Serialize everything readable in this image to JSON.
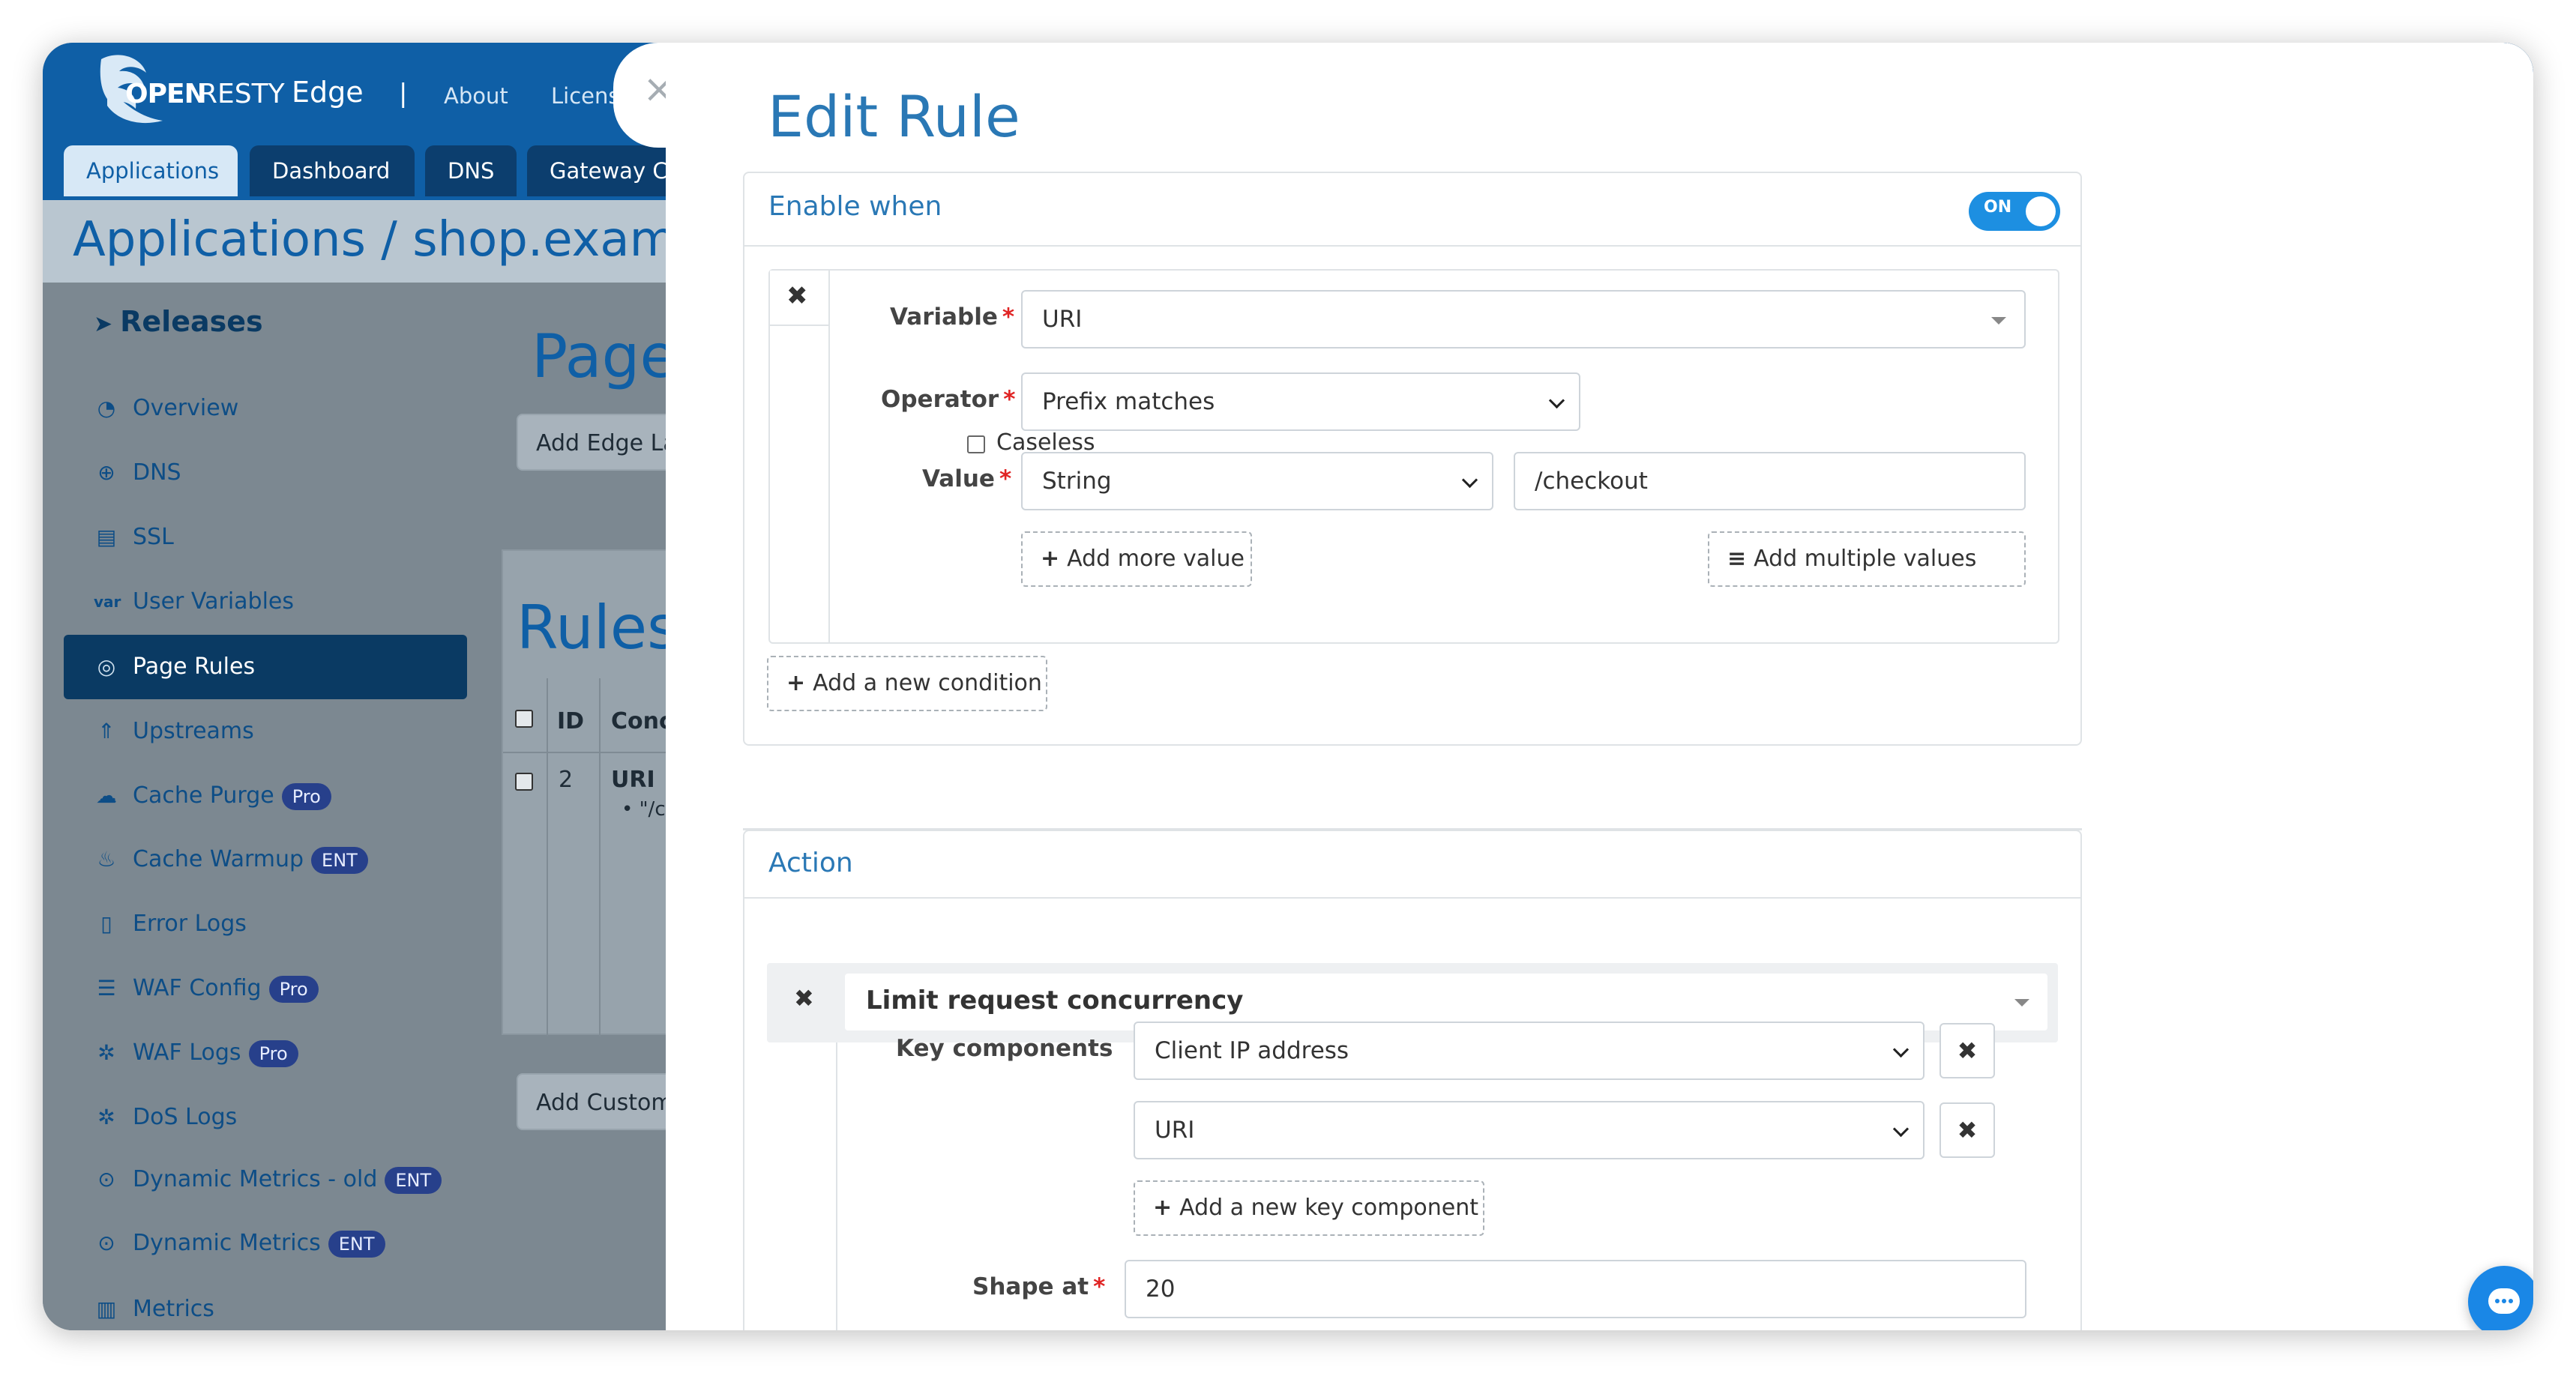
{
  "app": {
    "brand_open": "OPEN",
    "brand_resty": "RESTY",
    "brand_edge": "Edge",
    "separator": "|",
    "nav": {
      "about": "About",
      "license": "Licens"
    },
    "tabs": [
      "Applications",
      "Dashboard",
      "DNS",
      "Gateway Cl"
    ],
    "breadcrumb": "Applications / shop.examp"
  },
  "sidebar": {
    "heading": "Releases",
    "items": [
      {
        "label": "Overview",
        "icon": "gauge-icon",
        "glyph": "◔"
      },
      {
        "label": "DNS",
        "icon": "globe-icon",
        "glyph": "⊕"
      },
      {
        "label": "SSL",
        "icon": "certificate-icon",
        "glyph": "▤"
      },
      {
        "label": "User Variables",
        "icon": "var-icon",
        "glyph": "var"
      },
      {
        "label": "Page Rules",
        "icon": "rules-icon",
        "glyph": "◎"
      },
      {
        "label": "Upstreams",
        "icon": "upstream-icon",
        "glyph": "⇑"
      },
      {
        "label": "Cache Purge",
        "icon": "cloud-icon",
        "glyph": "☁",
        "badge": "Pro"
      },
      {
        "label": "Cache Warmup",
        "icon": "fire-icon",
        "glyph": "♨",
        "badge": "ENT"
      },
      {
        "label": "Error Logs",
        "icon": "file-icon",
        "glyph": "▯"
      },
      {
        "label": "WAF Config",
        "icon": "list-icon",
        "glyph": "☰",
        "badge": "Pro"
      },
      {
        "label": "WAF Logs",
        "icon": "bug-icon",
        "glyph": "✲",
        "badge": "Pro"
      },
      {
        "label": "DoS Logs",
        "icon": "shield-icon",
        "glyph": "✲"
      },
      {
        "label": "Dynamic Metrics - old",
        "icon": "pin-icon",
        "glyph": "⊙",
        "badge": "ENT"
      },
      {
        "label": "Dynamic Metrics",
        "icon": "pin-icon",
        "glyph": "⊙",
        "badge": "ENT"
      },
      {
        "label": "Metrics",
        "icon": "chart-icon",
        "glyph": "▥"
      }
    ]
  },
  "background": {
    "page_title": "Page",
    "add_edge_btn": "Add Edge La",
    "rules_title": "Rules",
    "table": {
      "col_id": "ID",
      "col_cond": "Conc",
      "row_id": "2",
      "row_cond": "URI",
      "row_bullet": "• \"/ch"
    },
    "add_custom_btn": "Add Custom"
  },
  "modal": {
    "close_glyph": "×",
    "title": "Edit Rule",
    "enable_when": {
      "title": "Enable when",
      "toggle_label": "ON",
      "condition": {
        "remove_glyph": "✖",
        "variable_label": "Variable",
        "variable_value": "URI",
        "operator_label": "Operator",
        "operator_value": "Prefix matches",
        "caseless_label": "Caseless",
        "value_label": "Value",
        "value_type": "String",
        "value_text": "/checkout",
        "add_more_value": "Add more value",
        "add_multiple_values": "Add multiple values",
        "required_mark": "*"
      },
      "add_condition": "Add a new condition",
      "plus_glyph": "+",
      "list_glyph": "≡"
    },
    "action": {
      "title": "Action",
      "remove_glyph": "✖",
      "selected": "Limit request concurrency",
      "key_components_label": "Key components",
      "key_components": [
        "Client IP address",
        "URI"
      ],
      "add_key_component": "Add a new key component",
      "shape_at_label": "Shape at",
      "shape_at_value": "20"
    }
  },
  "colors": {
    "brand_blue": "#0f5fa6",
    "title_blue": "#2a78b5",
    "toggle_on": "#1d8fe1",
    "required": "#e02424",
    "chat": "#1a87e6"
  }
}
